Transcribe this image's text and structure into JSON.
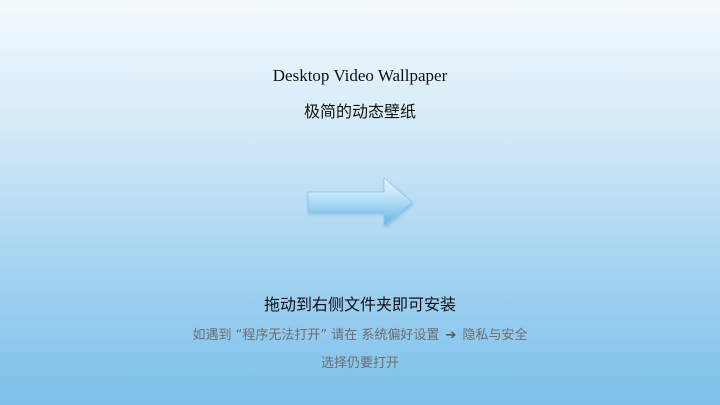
{
  "installer": {
    "title": "Desktop Video Wallpaper",
    "subtitle": "极简的动态壁纸",
    "instruction": "拖动到右侧文件夹即可安装",
    "hint_line1_part1": "如遇到 “程序无法打开” 请在 系统偏好设置",
    "hint_arrow": "➔",
    "hint_line1_part2": "隐私与安全",
    "hint_line2": "选择仍要打开",
    "arrow_icon": "drag-right-arrow-icon",
    "colors": {
      "arrow_fill_light": "#e8f5fd",
      "arrow_fill_dark": "#5fb3e6",
      "hint_text": "#6e6e6e"
    }
  }
}
